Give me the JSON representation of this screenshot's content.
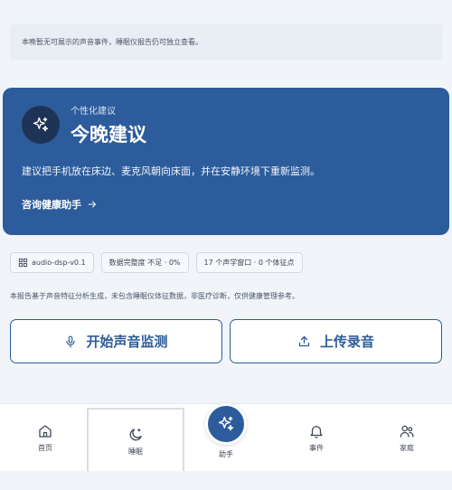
{
  "notice": {
    "text": "本晚暂无可展示的声音事件，睡眠仪报告仍可独立查看。"
  },
  "advice": {
    "kicker": "个性化建议",
    "title": "今晚建议",
    "description": "建议把手机放在床边、麦克风朝向床面，并在安静环境下重新监测。",
    "link_label": "咨询健康助手",
    "badge_icon": "sparkles-icon"
  },
  "chips": [
    {
      "label": "audio-dsp-v0.1",
      "icon": "chip-icon"
    },
    {
      "label": "数据完整度 不足 · 0%"
    },
    {
      "label": "17 个声学窗口 · 0 个体征点"
    }
  ],
  "disclaimer": "本报告基于声音特征分析生成，未包含睡眠仪体征数据，非医疗诊断，仅供健康管理参考。",
  "actions": {
    "start_label": "开始声音监测",
    "upload_label": "上传录音"
  },
  "nav": {
    "home": "首页",
    "sleep": "睡眠",
    "assistant": "助手",
    "events": "事件",
    "family": "家庭",
    "active": "sleep"
  },
  "colors": {
    "primary": "#2c5c9b",
    "badge": "#1f3357",
    "background": "#f1f5fa"
  }
}
